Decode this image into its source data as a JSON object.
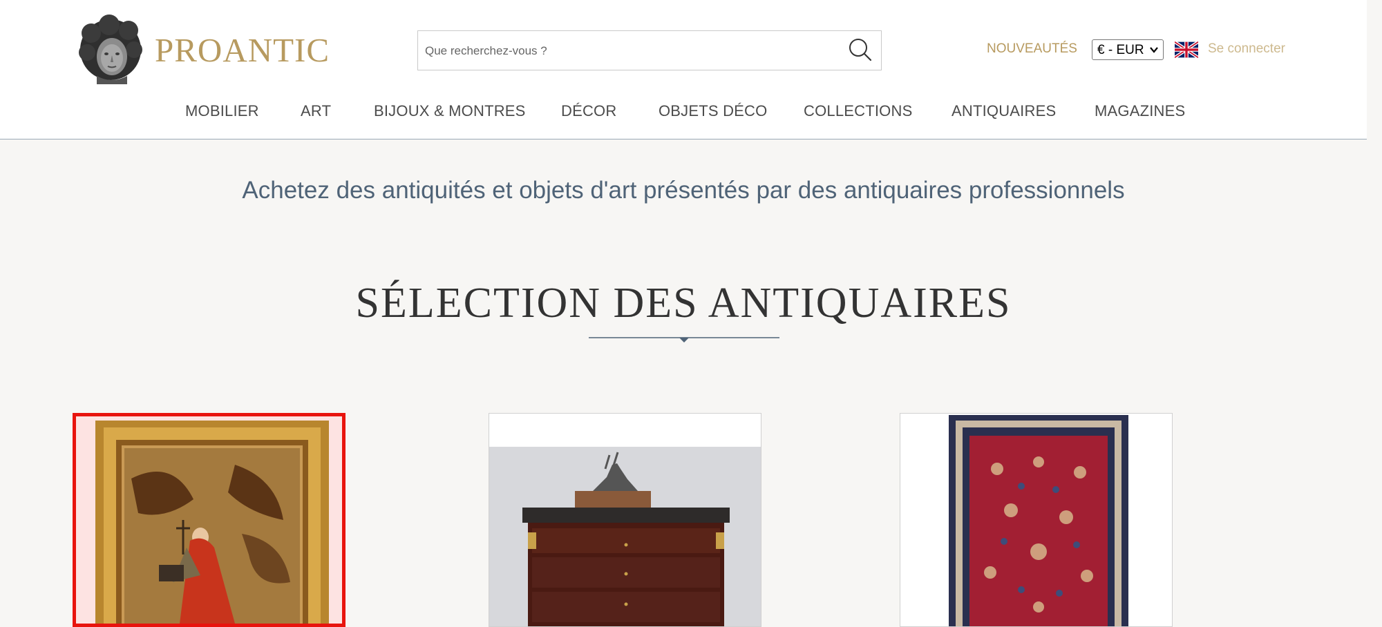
{
  "header": {
    "brand": "PROANTIC",
    "search": {
      "placeholder": "Que recherchez-vous ?",
      "value": ""
    },
    "new_link": "NOUVEAUTÉS",
    "currency": "€ - EUR",
    "login": "Se connecter"
  },
  "nav": {
    "items": [
      "MOBILIER",
      "ART",
      "BIJOUX & MONTRES",
      "DÉCOR",
      "OBJETS DÉCO",
      "COLLECTIONS",
      "ANTIQUAIRES",
      "MAGAZINES"
    ]
  },
  "main": {
    "tagline": "Achetez des antiquités et objets d'art présentés par des antiquaires professionnels",
    "section_title": "SÉLECTION DES ANTIQUAIRES"
  },
  "colors": {
    "brand_gold": "#b79a5f",
    "accent_blue": "#4f6377",
    "highlight_red": "#e8140e"
  },
  "icons": [
    "bust-logo-icon",
    "search-icon",
    "chevron-down-icon",
    "uk-flag-icon",
    "divider-diamond-icon"
  ]
}
